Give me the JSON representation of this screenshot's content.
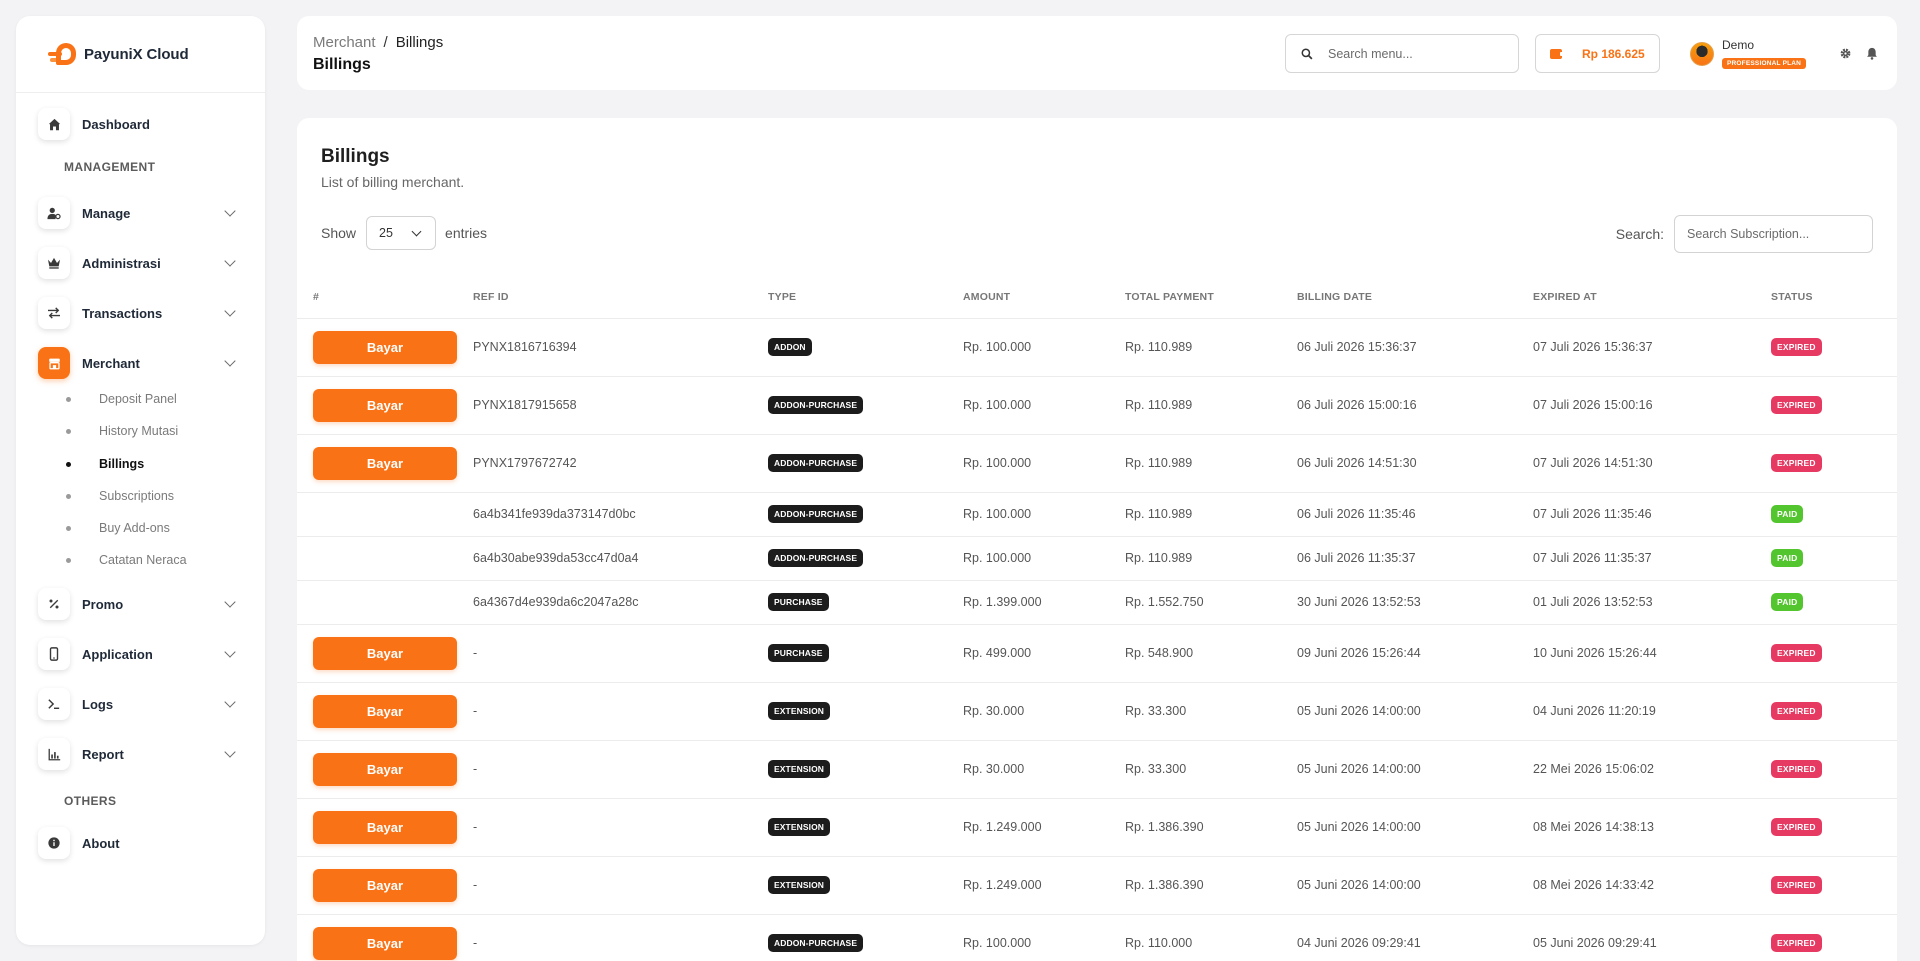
{
  "brand": {
    "name": "PayuniX Cloud"
  },
  "sidebar": {
    "dashboard": "Dashboard",
    "section_management": "MANAGEMENT",
    "manage": "Manage",
    "administrasi": "Administrasi",
    "transactions": "Transactions",
    "merchant": "Merchant",
    "sub_items": [
      "Deposit Panel",
      "History Mutasi",
      "Billings",
      "Subscriptions",
      "Buy Add-ons",
      "Catatan Neraca"
    ],
    "promo": "Promo",
    "application": "Application",
    "logs": "Logs",
    "report": "Report",
    "section_others": "OTHERS",
    "about": "About"
  },
  "topbar": {
    "breadcrumb_parent": "Merchant",
    "breadcrumb_sep": "/",
    "breadcrumb_current": "Billings",
    "page_title": "Billings",
    "search_placeholder": "Search menu...",
    "balance": "Rp 186.625",
    "user_name": "Demo",
    "user_plan": "PROFESSIONAL PLAN"
  },
  "card": {
    "title": "Billings",
    "subtitle": "List of billing merchant.",
    "show_label": "Show",
    "entries_value": "25",
    "entries_label": "entries",
    "search_label": "Search:",
    "search_placeholder": "Search Subscription..."
  },
  "table": {
    "headers": [
      "#",
      "REF ID",
      "TYPE",
      "AMOUNT",
      "TOTAL PAYMENT",
      "BILLING DATE",
      "EXPIRED AT",
      "STATUS"
    ],
    "pay_label": "Bayar",
    "rows": [
      {
        "pay": true,
        "ref": "PYNX1816716394",
        "type": "ADDON",
        "amount": "Rp. 100.000",
        "total": "Rp. 110.989",
        "billing": "06 Juli 2026 15:36:37",
        "expired": "07 Juli 2026 15:36:37",
        "status": "EXPIRED"
      },
      {
        "pay": true,
        "ref": "PYNX1817915658",
        "type": "ADDON-PURCHASE",
        "amount": "Rp. 100.000",
        "total": "Rp. 110.989",
        "billing": "06 Juli 2026 15:00:16",
        "expired": "07 Juli 2026 15:00:16",
        "status": "EXPIRED"
      },
      {
        "pay": true,
        "ref": "PYNX1797672742",
        "type": "ADDON-PURCHASE",
        "amount": "Rp. 100.000",
        "total": "Rp. 110.989",
        "billing": "06 Juli 2026 14:51:30",
        "expired": "07 Juli 2026 14:51:30",
        "status": "EXPIRED"
      },
      {
        "pay": false,
        "ref": "6a4b341fe939da373147d0bc",
        "type": "ADDON-PURCHASE",
        "amount": "Rp. 100.000",
        "total": "Rp. 110.989",
        "billing": "06 Juli 2026 11:35:46",
        "expired": "07 Juli 2026 11:35:46",
        "status": "PAID"
      },
      {
        "pay": false,
        "ref": "6a4b30abe939da53cc47d0a4",
        "type": "ADDON-PURCHASE",
        "amount": "Rp. 100.000",
        "total": "Rp. 110.989",
        "billing": "06 Juli 2026 11:35:37",
        "expired": "07 Juli 2026 11:35:37",
        "status": "PAID"
      },
      {
        "pay": false,
        "ref": "6a4367d4e939da6c2047a28c",
        "type": "PURCHASE",
        "amount": "Rp. 1.399.000",
        "total": "Rp. 1.552.750",
        "billing": "30 Juni 2026 13:52:53",
        "expired": "01 Juli 2026 13:52:53",
        "status": "PAID"
      },
      {
        "pay": true,
        "ref": "-",
        "type": "PURCHASE",
        "amount": "Rp. 499.000",
        "total": "Rp. 548.900",
        "billing": "09 Juni 2026 15:26:44",
        "expired": "10 Juni 2026 15:26:44",
        "status": "EXPIRED"
      },
      {
        "pay": true,
        "ref": "-",
        "type": "EXTENSION",
        "amount": "Rp. 30.000",
        "total": "Rp. 33.300",
        "billing": "05 Juni 2026 14:00:00",
        "expired": "04 Juni 2026 11:20:19",
        "status": "EXPIRED"
      },
      {
        "pay": true,
        "ref": "-",
        "type": "EXTENSION",
        "amount": "Rp. 30.000",
        "total": "Rp. 33.300",
        "billing": "05 Juni 2026 14:00:00",
        "expired": "22 Mei 2026 15:06:02",
        "status": "EXPIRED"
      },
      {
        "pay": true,
        "ref": "-",
        "type": "EXTENSION",
        "amount": "Rp. 1.249.000",
        "total": "Rp. 1.386.390",
        "billing": "05 Juni 2026 14:00:00",
        "expired": "08 Mei 2026 14:38:13",
        "status": "EXPIRED"
      },
      {
        "pay": true,
        "ref": "-",
        "type": "EXTENSION",
        "amount": "Rp. 1.249.000",
        "total": "Rp. 1.386.390",
        "billing": "05 Juni 2026 14:00:00",
        "expired": "08 Mei 2026 14:33:42",
        "status": "EXPIRED"
      },
      {
        "pay": true,
        "ref": "-",
        "type": "ADDON-PURCHASE",
        "amount": "Rp. 100.000",
        "total": "Rp. 110.000",
        "billing": "04 Juni 2026 09:29:41",
        "expired": "05 Juni 2026 09:29:41",
        "status": "EXPIRED"
      }
    ]
  },
  "colors": {
    "accent": "#f97316",
    "expired": "#e63a63",
    "paid": "#53c52e",
    "badge_dark": "#1c1c1c"
  }
}
